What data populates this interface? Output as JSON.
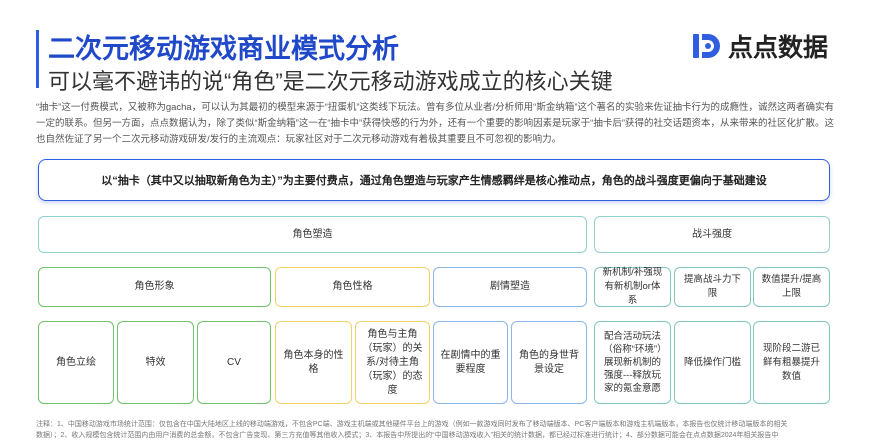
{
  "header": {
    "title": "二次元移动游戏商业模式分析",
    "subtitle": "可以毫不避讳的说“角色”是二次元移动游戏成立的核心关键"
  },
  "logo": {
    "text": "点点数据",
    "icon": "dd-logo-icon",
    "color": "#2f5fe0"
  },
  "intro": "“抽卡”这一付费模式，又被称为gacha，可以认为其最初的模型来源于“扭蛋机”这类线下玩法。曾有多位从业者/分析师用“斯金纳箱”这个著名的实验来佐证抽卡行为的成瘾性，诚然这两者确实有一定的联系。但另一方面，点点数据认为，除了类似“斯金纳箱”这一在“抽卡中”获得快感的行为外，还有一个重要的影响因素是玩家于“抽卡后”获得的社交话题资本，从来带来的社区化扩散。这也自然佐证了另一个二次元移动游戏研发/发行的主流观点：玩家社区对于二次元移动游戏有着极其重要且不可忽视的影响力。",
  "summary": "以“抽卡（其中又以抽取新角色为主）”为主要付费点，通过角色塑造与玩家产生情感羁绊是核心推动点，角色的战斗强度更偏向于基础建设",
  "level1": [
    "角色塑造",
    "战斗强度"
  ],
  "level2": [
    "角色形象",
    "角色性格",
    "剧情塑造",
    "新机制/补强现有新机制or体系",
    "提高战斗力下限",
    "数值提升/提高上限"
  ],
  "level3": [
    "角色立绘",
    "特效",
    "CV",
    "角色本身的性格",
    "角色与主角（玩家）的关系/对待主角（玩家）的态度",
    "在剧情中的重要程度",
    "角色的身世背景设定",
    "配合活动玩法（俗称“环境”）展现新机制的强度---释放玩家的氪金意愿",
    "降低操作门槛",
    "现阶段二游已鲜有粗暴提升数值"
  ],
  "footnote": {
    "line1": "注释：1、中国移动游戏市场统计范围：仅包含在中国大陆地区上线的移动端游戏，不包含PC端、游戏主机端或其他硬件平台上的游戏（例如一款游戏同时发布了移动端版本、PC客户端版本和游戏主机端版本，本报告也仅统计移动端版本的相关",
    "line2": "数据）；2、收入规模包含统计范围内由用户消费的总金额，不包含广告变现、第三方充值等其他收入模式；3、本报告中所提出的“中国移动游戏收入”相关的统计数据，都已经过标准进行统计；4、部分数据可能会在点点数据2024年相关报告中"
  }
}
